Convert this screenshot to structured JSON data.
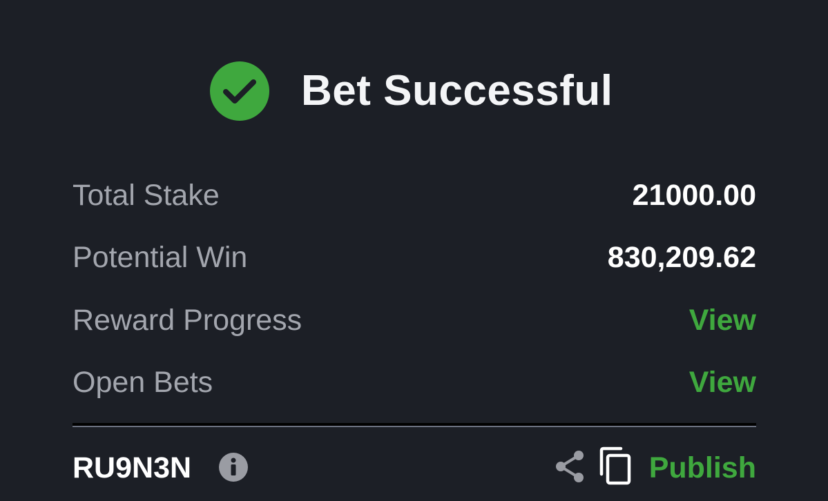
{
  "header": {
    "title": "Bet Successful",
    "icon": "check-circle-icon"
  },
  "summary": {
    "rows": [
      {
        "label": "Total Stake",
        "value": "21000.00"
      },
      {
        "label": "Potential Win",
        "value": "830,209.62"
      },
      {
        "label": "Reward Progress",
        "link": "View"
      },
      {
        "label": "Open Bets",
        "link": "View"
      }
    ]
  },
  "footer": {
    "booking_code": "RU9N3N",
    "info_icon": "info-icon",
    "share_icon": "share-icon",
    "copy_icon": "copy-icon",
    "publish_label": "Publish"
  },
  "colors": {
    "background": "#1c1f26",
    "accent_green": "#3fa83e",
    "label_gray": "#a3a6ae",
    "icon_gray": "#9a9ca3"
  }
}
